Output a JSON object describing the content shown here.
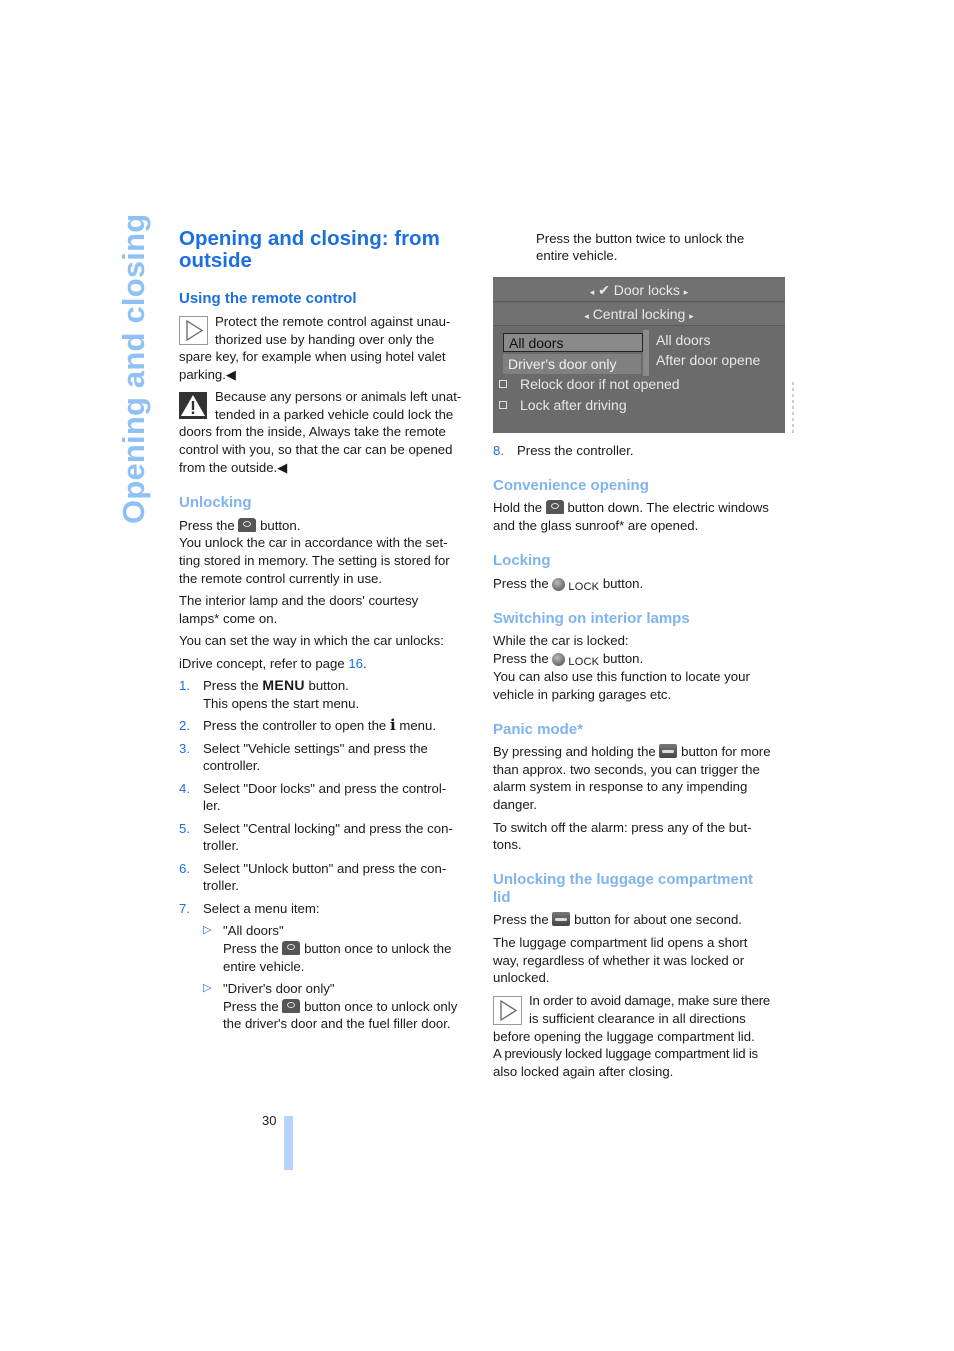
{
  "side_tab": "Opening and closing",
  "page_number": "30",
  "left": {
    "title": "Opening and closing: from outside",
    "remote_heading": "Using the remote control",
    "note1": "Protect the remote control against unauthorized use by handing over only the spare key, for example when using hotel valet parking.",
    "note1_lines": [
      "Protect the remote control against unau-",
      "thorized use by handing over only the",
      "spare key, for example when using hotel valet",
      "parking.◀"
    ],
    "warning_lines": [
      "Because any persons or animals left unat-",
      "tended in a parked vehicle could lock the",
      "doors from the inside, Always take the remote",
      "control with you, so that the car can be opened",
      "from the outside.◀"
    ],
    "unlocking_heading": "Unlocking",
    "press_the": "Press the",
    "button": "button.",
    "unlock_lines": [
      "You unlock the car in accordance with the set-",
      "ting stored in memory. The setting is stored for",
      "the remote control currently in use."
    ],
    "lamp_lines": [
      "The interior lamp and the doors' courtesy",
      "lamps* come on."
    ],
    "set_way": "You can set the way in which the car unlocks:",
    "idrive_prefix": "iDrive concept, refer to page ",
    "idrive_page": "16",
    "idrive_suffix": ".",
    "steps": [
      {
        "n": "1.",
        "lines": [
          "Press the MENU button.",
          "This opens the start menu."
        ]
      },
      {
        "n": "2.",
        "lines": [
          "Press the controller to open the i menu."
        ]
      },
      {
        "n": "3.",
        "lines": [
          "Select \"Vehicle settings\" and press the",
          "controller."
        ]
      },
      {
        "n": "4.",
        "lines": [
          "Select \"Door locks\" and press the control-",
          "ler."
        ]
      },
      {
        "n": "5.",
        "lines": [
          "Select \"Central locking\" and press the con-",
          "troller."
        ]
      },
      {
        "n": "6.",
        "lines": [
          "Select \"Unlock button\" and press the con-",
          "troller."
        ]
      },
      {
        "n": "7.",
        "lines": [
          "Select a menu item:"
        ]
      }
    ],
    "step1_a": "Press the",
    "step1_menu": "MENU",
    "step1_b": "button.",
    "step1_c": "This opens the start menu.",
    "step2_a": "Press the controller to open the",
    "step2_i": "i",
    "step2_b": "menu.",
    "subitems": [
      {
        "title": "\"All doors\"",
        "a": "Press the",
        "b": "button once to unlock the",
        "c": "entire vehicle."
      },
      {
        "title": "\"Driver's door only\"",
        "a": "Press the",
        "b": "button once to unlock only",
        "c": "the driver's door and the fuel filler door."
      }
    ]
  },
  "right": {
    "twice_lines": [
      "Press the button twice to unlock the",
      "entire vehicle."
    ],
    "screen": {
      "header1": "Door locks",
      "header2": "Central locking",
      "options": [
        "All doors",
        "Driver's door only"
      ],
      "values": [
        "All doors",
        "After door opene"
      ],
      "checkboxes": [
        "Relock door if not opened",
        "Lock after driving"
      ]
    },
    "step8_n": "8.",
    "step8": "Press the controller.",
    "convenience_heading": "Convenience opening",
    "convenience_a": "Hold the",
    "convenience_b": "button down. The electric windows",
    "convenience_c": "and the glass sunroof* are opened.",
    "locking_heading": "Locking",
    "press_the": "Press the",
    "lock_label": "LOCK",
    "button": "button.",
    "lamps_heading": "Switching on interior lamps",
    "lamps_l1": "While the car is locked:",
    "lamps_l3": "You can also use this function to locate your",
    "lamps_l4": "vehicle in parking garages etc.",
    "panic_heading": "Panic mode*",
    "panic_a": "By pressing and holding the",
    "panic_b": "button for more",
    "panic_lines": [
      "than approx. two seconds, you can trigger the",
      "alarm system in response to any impending",
      "danger."
    ],
    "alarm_off_lines": [
      "To switch off the alarm: press any of the but-",
      "tons."
    ],
    "luggage_heading_lines": [
      "Unlocking the luggage compartment",
      "lid"
    ],
    "luggage_a": "Press the",
    "luggage_b": "button for about one second.",
    "luggage_lines": [
      "The luggage compartment lid opens a short",
      "way, regardless of whether it was locked or",
      "unlocked."
    ],
    "note_lines": [
      "In order to avoid damage, make sure there",
      "is sufficient clearance in all directions",
      "before opening the luggage compartment lid.",
      "A previously locked luggage compartment lid is",
      "also locked again after closing."
    ]
  }
}
